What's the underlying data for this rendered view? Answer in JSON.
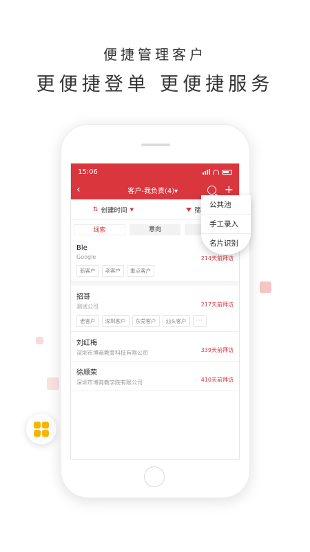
{
  "promo": {
    "headline1": "便捷管理客户",
    "headline2": "更便捷登单  更便捷服务"
  },
  "colors": {
    "brand_red": "#d9363e",
    "app_icon": "#f7b500"
  },
  "status_bar": {
    "time": "15:06"
  },
  "nav": {
    "back_icon": "‹",
    "title": "客户-我负责(4)▾",
    "plus_icon": "+"
  },
  "filters": {
    "sort_label": "创建时间",
    "filter_label": "筛"
  },
  "tabs": [
    {
      "label": "线索",
      "active": true
    },
    {
      "label": "意向",
      "active": false
    },
    {
      "label": "",
      "active": false
    }
  ],
  "dropdown": {
    "items": [
      "公共池",
      "手工录入",
      "名片识别"
    ]
  },
  "customers": [
    {
      "name": "Ble",
      "company": "Google",
      "visit": "214天前拜访",
      "tags": [
        "新客户",
        "老客户",
        "重点客户"
      ]
    },
    {
      "name": "招哥",
      "company": "测试公司",
      "visit": "217天前拜访",
      "tags": [
        "老客户",
        "深圳客户",
        "东莞客户",
        "汕头客户"
      ],
      "more": "···"
    },
    {
      "name": "刘红梅",
      "company": "深圳市博商教育科技有限公司",
      "visit": "339天前拜访",
      "tags": []
    },
    {
      "name": "徐顺荣",
      "company": "深圳市博商教学院有限公司",
      "visit": "410天前拜访",
      "tags": []
    }
  ]
}
